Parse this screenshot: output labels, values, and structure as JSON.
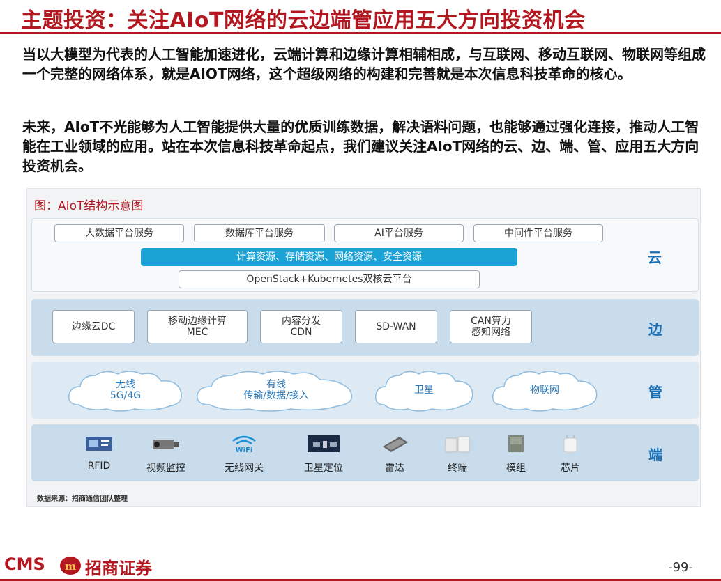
{
  "title": "主题投资：关注AIoT网络的云边端管应用五大方向投资机会",
  "paragraphs": [
    "当以大模型为代表的人工智能加速进化，云端计算和边缘计算相辅相成，与互联网、移动互联网、物联网等组成一个完整的网络体系，就是AIOT网络，这个超级网络的构建和完善就是本次信息科技革命的核心。",
    "未来，AIoT不光能够为人工智能提供大量的优质训练数据，解决语料问题，也能够通过强化连接，推动人工智能在工业领域的应用。站在本次信息科技革命起点，我们建议关注AIoT网络的云、边、端、管、应用五大方向投资机会。"
  ],
  "figure": {
    "caption": "图：AIoT结构示意图",
    "cloud": {
      "label": "云",
      "services": [
        "大数据平台服务",
        "数据库平台服务",
        "AI平台服务",
        "中间件平台服务"
      ],
      "resources": "计算资源、存储资源、网络资源、安全资源",
      "platform": "OpenStack+Kubernetes双核云平台"
    },
    "edge": {
      "label": "边",
      "items": [
        {
          "line1": "边缘云DC",
          "line2": ""
        },
        {
          "line1": "移动边缘计算",
          "line2": "MEC"
        },
        {
          "line1": "内容分发",
          "line2": "CDN"
        },
        {
          "line1": "SD-WAN",
          "line2": ""
        },
        {
          "line1": "CAN算力",
          "line2": "感知网络"
        }
      ]
    },
    "pipe": {
      "label": "管",
      "items": [
        {
          "line1": "无线",
          "line2": "5G/4G"
        },
        {
          "line1": "有线",
          "line2": "传输/数据/接入"
        },
        {
          "line1": "卫星",
          "line2": ""
        },
        {
          "line1": "物联网",
          "line2": ""
        }
      ]
    },
    "terminal": {
      "label": "端",
      "items": [
        {
          "label": "RFID",
          "icon": "rfid-card-icon"
        },
        {
          "label": "视频监控",
          "icon": "camera-icon"
        },
        {
          "label": "无线网关",
          "icon": "wifi-icon"
        },
        {
          "label": "卫星定位",
          "icon": "satellite-icon"
        },
        {
          "label": "雷达",
          "icon": "radar-icon"
        },
        {
          "label": "终端",
          "icon": "terminal-icon"
        },
        {
          "label": "模组",
          "icon": "module-icon"
        },
        {
          "label": "芯片",
          "icon": "chip-icon"
        }
      ]
    },
    "source": "数据来源：招商通信团队整理"
  },
  "footer": {
    "logo_text": "CMS",
    "logo_mark": "m",
    "company": "招商证券",
    "page": "-99-"
  },
  "colors": {
    "brand": "#b3171f",
    "accent_blue": "#1aa3d4",
    "label_blue": "#1a6fb5"
  }
}
